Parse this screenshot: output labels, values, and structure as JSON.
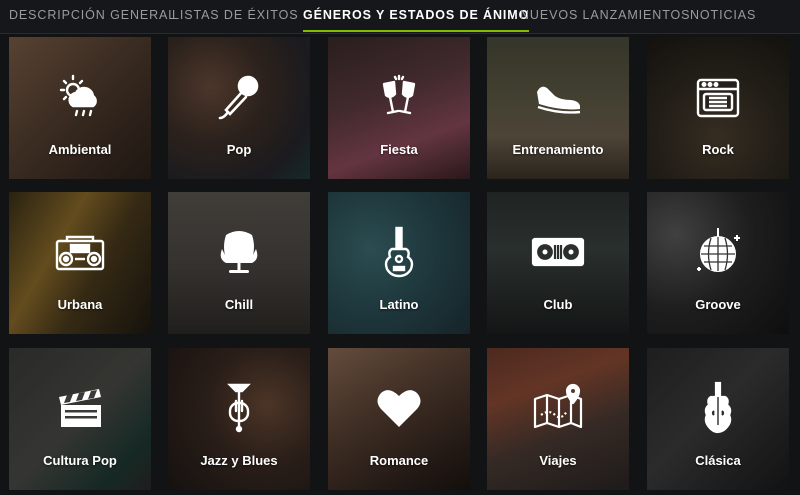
{
  "tabs": [
    {
      "label": "DESCRIPCIÓN GENERAL",
      "active": false
    },
    {
      "label": "LISTAS DE ÉXITOS",
      "active": false
    },
    {
      "label": "GÉNEROS Y ESTADOS DE ÁNIMO",
      "active": true
    },
    {
      "label": "NUEVOS LANZAMIENTOS",
      "active": false
    },
    {
      "label": "NOTICIAS",
      "active": false
    }
  ],
  "accent_color": "#84bd00",
  "tiles": [
    {
      "label": "Ambiental",
      "icon": "weather-sun-cloud-rain-icon"
    },
    {
      "label": "Pop",
      "icon": "microphone-icon"
    },
    {
      "label": "Fiesta",
      "icon": "champagne-glasses-icon"
    },
    {
      "label": "Entrenamiento",
      "icon": "sneaker-icon"
    },
    {
      "label": "Rock",
      "icon": "amplifier-icon"
    },
    {
      "label": "Urbana",
      "icon": "boombox-icon"
    },
    {
      "label": "Chill",
      "icon": "egg-chair-icon"
    },
    {
      "label": "Latino",
      "icon": "guitar-icon"
    },
    {
      "label": "Club",
      "icon": "turntables-icon"
    },
    {
      "label": "Groove",
      "icon": "disco-ball-icon"
    },
    {
      "label": "Cultura Pop",
      "icon": "clapperboard-icon"
    },
    {
      "label": "Jazz y Blues",
      "icon": "trumpet-icon"
    },
    {
      "label": "Romance",
      "icon": "heart-icon"
    },
    {
      "label": "Viajes",
      "icon": "map-pin-icon"
    },
    {
      "label": "Clásica",
      "icon": "violin-icon"
    }
  ]
}
